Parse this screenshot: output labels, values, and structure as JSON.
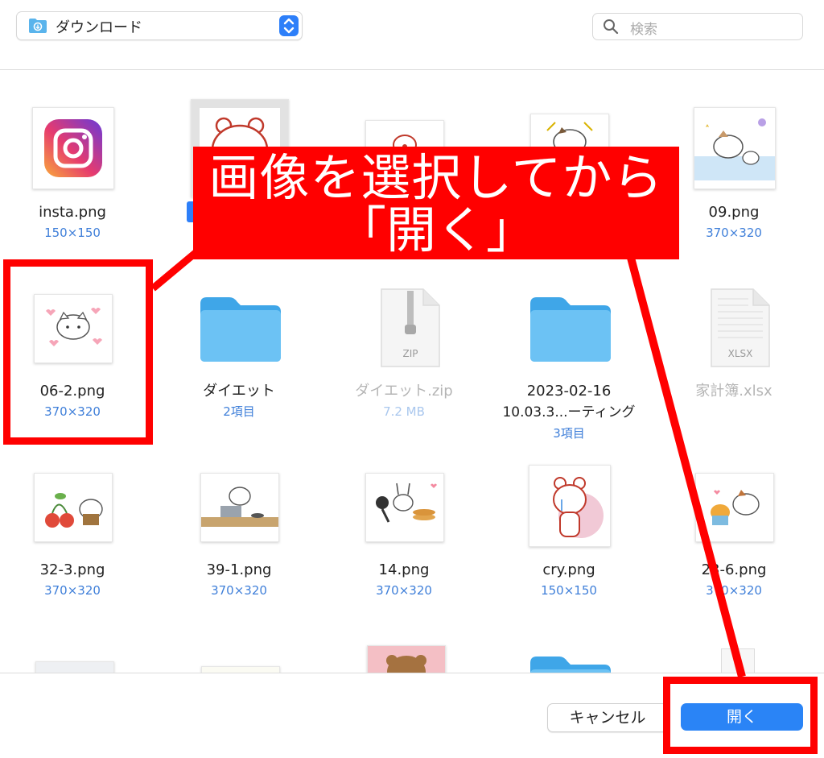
{
  "location": {
    "label": "ダウンロード"
  },
  "search": {
    "placeholder": "検索"
  },
  "items": [
    {
      "name": "insta.png",
      "sub": "150×150"
    },
    {
      "name": "",
      "sub": ""
    },
    {
      "name": "",
      "sub": ""
    },
    {
      "name": "",
      "sub": ""
    },
    {
      "name": "09.png",
      "sub": "370×320"
    },
    {
      "name": "06-2.png",
      "sub": "370×320"
    },
    {
      "name": "ダイエット",
      "sub": "2項目"
    },
    {
      "name": "ダイエット.zip",
      "sub": "7.2 MB"
    },
    {
      "name": "2023-02-16",
      "name2": "10.03.3...ーティング",
      "sub": "3項目"
    },
    {
      "name": "家計簿.xlsx",
      "sub": ""
    },
    {
      "name": "32-3.png",
      "sub": "370×320"
    },
    {
      "name": "39-1.png",
      "sub": "370×320"
    },
    {
      "name": "14.png",
      "sub": "370×320"
    },
    {
      "name": "cry.png",
      "sub": "150×150"
    },
    {
      "name": "23-6.png",
      "sub": "370×320"
    }
  ],
  "file_icons": {
    "zip": "ZIP",
    "xlsx": "XLSX"
  },
  "buttons": {
    "cancel": "キャンセル",
    "open": "開く"
  },
  "annotation": {
    "line1": "画像を選択してから",
    "line2": "「開く」"
  },
  "colors": {
    "accent": "#2a84f6",
    "annotation": "#ff0000",
    "folder": "#4fb3f0"
  }
}
